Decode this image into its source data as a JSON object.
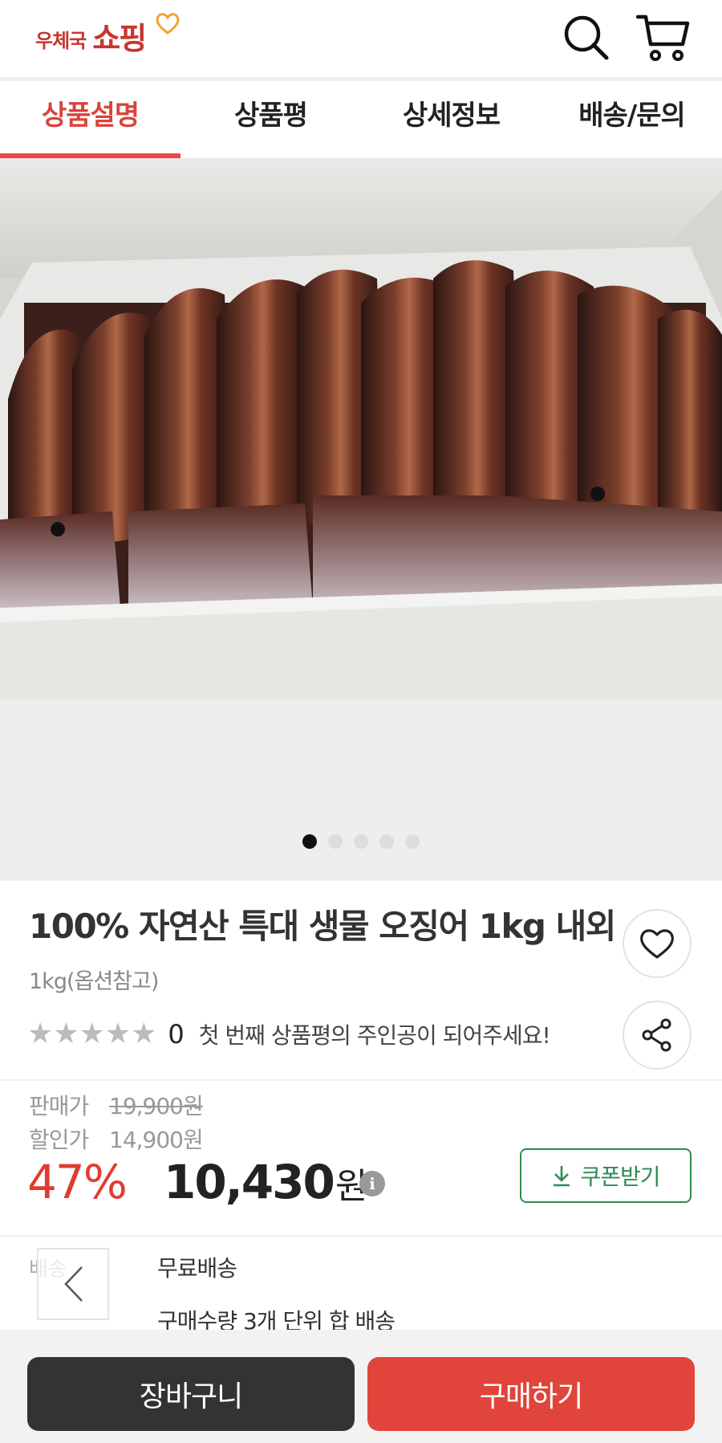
{
  "header": {
    "logo_small": "우체국",
    "logo_large": "쇼핑",
    "search_icon": "search-icon",
    "cart_icon": "cart-icon"
  },
  "tabs": [
    {
      "label": "상품설명",
      "active": true
    },
    {
      "label": "상품평",
      "active": false
    },
    {
      "label": "상세정보",
      "active": false
    },
    {
      "label": "배송/문의",
      "active": false
    }
  ],
  "gallery": {
    "total_images": 5,
    "current_index": 1
  },
  "product": {
    "title": "100% 자연산 특대 생물 오징어 1kg 내외",
    "subtitle": "1kg(옵션참고)",
    "rating_stars": "★★★★★",
    "rating_count": "0",
    "review_prompt": "첫 번째 상품평의 주인공이 되어주세요!"
  },
  "price": {
    "sale_label": "판매가",
    "sale_price": "19,900원",
    "discount_label": "할인가",
    "discount_price": "14,900원",
    "discount_rate": "47%",
    "final_price": "10,430",
    "currency": "원",
    "info": "i",
    "coupon_label": "쿠폰받기"
  },
  "shipping": {
    "label": "배송",
    "fee": "무료배송",
    "note": "구매수량 3개 단위 합 배송"
  },
  "bottom": {
    "cart_label": "장바구니",
    "buy_label": "구매하기"
  },
  "colors": {
    "accent": "#e0443a",
    "coupon": "#2e8b55",
    "dark": "#333333"
  }
}
